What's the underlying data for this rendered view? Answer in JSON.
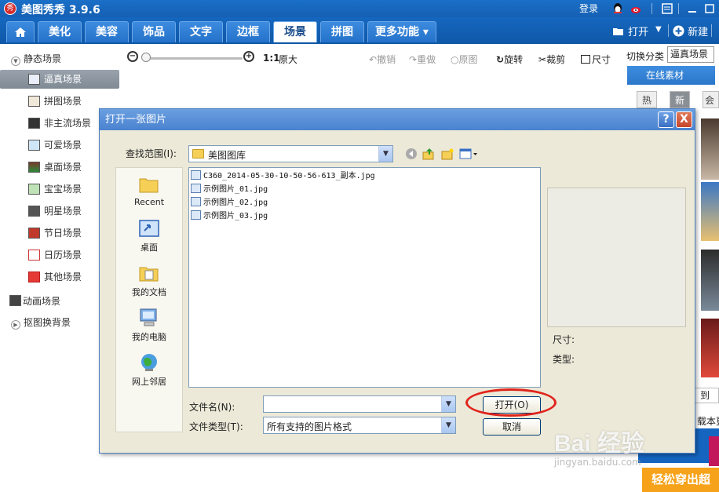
{
  "app": {
    "title": "美图秀秀 3.9.6",
    "logo_text": "秀",
    "login": "登录"
  },
  "tabs": [
    {
      "label": "美化"
    },
    {
      "label": "美容"
    },
    {
      "label": "饰品"
    },
    {
      "label": "文字"
    },
    {
      "label": "边框"
    },
    {
      "label": "场景",
      "active": true
    },
    {
      "label": "拼图"
    },
    {
      "label": "更多功能 ▾"
    }
  ],
  "tabbar_right": {
    "open": "打开",
    "new": "新建"
  },
  "sidebar": {
    "static_group": "静态场景",
    "items": [
      {
        "label": "逼真场景",
        "active": true
      },
      {
        "label": "拼图场景"
      },
      {
        "label": "非主流场景"
      },
      {
        "label": "可爱场景"
      },
      {
        "label": "桌面场景"
      },
      {
        "label": "宝宝场景"
      },
      {
        "label": "明星场景"
      },
      {
        "label": "节日场景"
      },
      {
        "label": "日历场景"
      },
      {
        "label": "其他场景"
      }
    ],
    "animated_group": "动画场景",
    "cutout_group": "抠图换背景"
  },
  "toolbar": {
    "zoom_value": 0,
    "actual_size_label": "1:1",
    "original_size": "原大",
    "undo": "撤销",
    "redo": "重做",
    "original": "原图",
    "rotate": "旋转",
    "crop": "裁剪",
    "resize": "尺寸"
  },
  "right_panel": {
    "category_label": "切换分类",
    "category_value": "逼真场景",
    "online_tab": "在线素材",
    "subtabs": [
      "热门",
      "新鲜",
      "会"
    ],
    "goto": "到",
    "download": "载本更",
    "banner": "轻松穿出超"
  },
  "dialog": {
    "title": "打开一张图片",
    "help": "?",
    "close": "X",
    "lookin_label": "查找范围(I):",
    "lookin_value": "美图图库",
    "places": [
      "Recent",
      "桌面",
      "我的文档",
      "我的电脑",
      "网上邻居"
    ],
    "files": [
      "C360_2014-05-30-10-50-56-613_副本.jpg",
      "示例图片_01.jpg",
      "示例图片_02.jpg",
      "示例图片_03.jpg"
    ],
    "size_label": "尺寸:",
    "type_label": "类型:",
    "filename_label": "文件名(N):",
    "filename_value": "",
    "filetype_label": "文件类型(T):",
    "filetype_value": "所有支持的图片格式",
    "open_button": "打开(O)",
    "cancel_button": "取消"
  },
  "watermark": {
    "brand": "Bai 经验",
    "url": "jingyan.baidu.com"
  },
  "colors": {
    "titlebar": "#1a6fc7",
    "tab_active_text": "#1a4d8c",
    "highlight": "#e0241c",
    "dialog_bg": "#ece9d8"
  }
}
